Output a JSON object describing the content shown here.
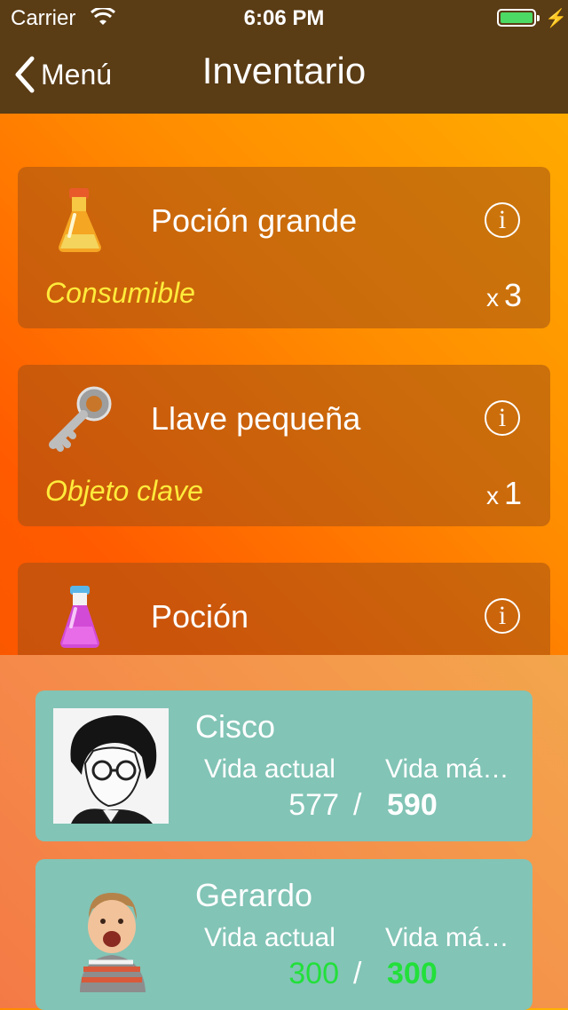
{
  "status_bar": {
    "carrier": "Carrier",
    "time": "6:06 PM"
  },
  "nav": {
    "back_label": "Menú",
    "title": "Inventario"
  },
  "items": [
    {
      "name": "Poción grande",
      "type": "Consumible",
      "qty_prefix": "x",
      "qty": "3",
      "icon": "large-potion-icon"
    },
    {
      "name": "Llave pequeña",
      "type": "Objeto clave",
      "qty_prefix": "x",
      "qty": "1",
      "icon": "key-icon"
    },
    {
      "name": "Poción",
      "type": "",
      "qty_prefix": "",
      "qty": "",
      "icon": "potion-icon"
    }
  ],
  "info_glyph": "i",
  "party": [
    {
      "name": "Cisco",
      "label_current": "Vida actual",
      "label_max": "Vida má…",
      "current": "577",
      "separator": "/",
      "max": "590",
      "current_color": "#ffffff",
      "max_color": "#ffffff"
    },
    {
      "name": "Gerardo",
      "label_current": "Vida actual",
      "label_max": "Vida má…",
      "current": "300",
      "separator": "/",
      "max": "300",
      "current_color": "#22e03a",
      "max_color": "#22e03a"
    }
  ]
}
